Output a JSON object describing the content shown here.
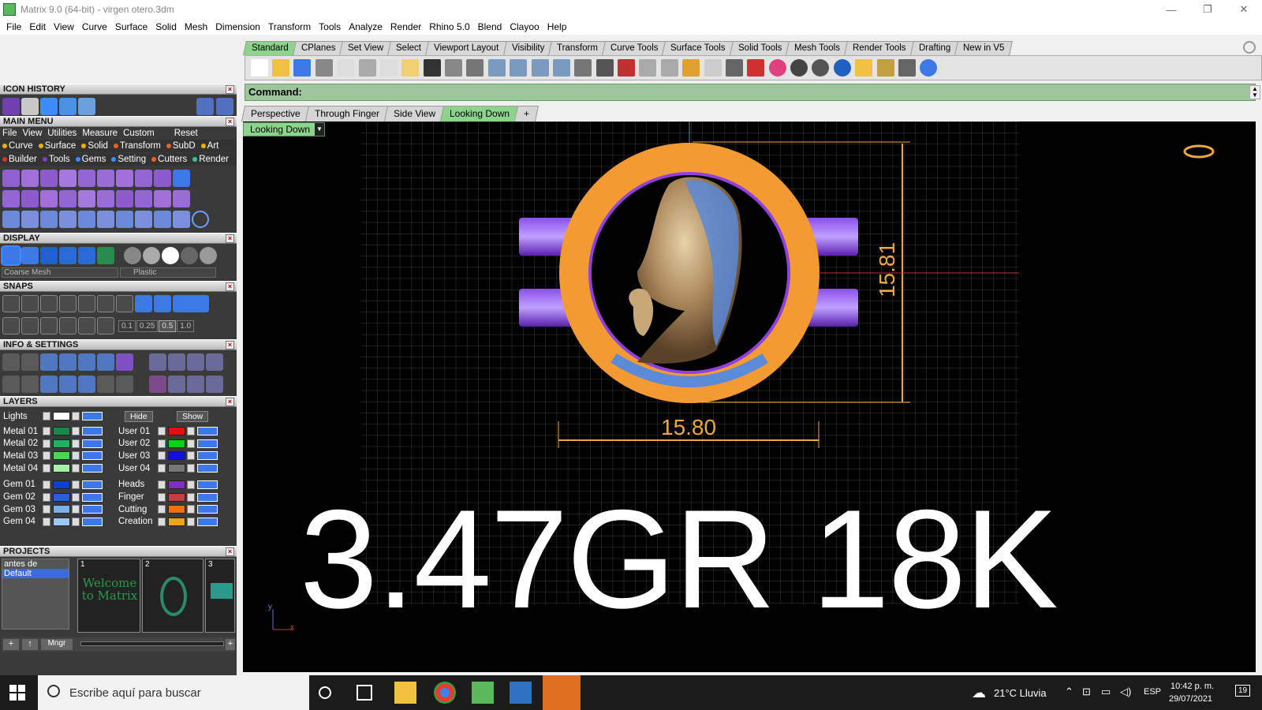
{
  "window": {
    "title": "Matrix 9.0 (64-bit) - virgen otero.3dm",
    "min": "—",
    "max": "❐",
    "close": "✕"
  },
  "menubar": [
    "File",
    "Edit",
    "View",
    "Curve",
    "Surface",
    "Solid",
    "Mesh",
    "Dimension",
    "Transform",
    "Tools",
    "Analyze",
    "Render",
    "Rhino 5.0",
    "Blend",
    "Clayoo",
    "Help"
  ],
  "left": {
    "icon_history": "ICON HISTORY",
    "main_menu": "MAIN MENU",
    "main_menu_items": [
      "File",
      "View",
      "Utilities",
      "Measure",
      "Custom"
    ],
    "reset": "Reset",
    "cat_row1": [
      "Curve",
      "Surface",
      "Solid",
      "Transform",
      "SubD",
      "Art"
    ],
    "cat_row2": [
      "Builder",
      "Tools",
      "Gems",
      "Setting",
      "Cutters",
      "Render"
    ],
    "display": "DISPLAY",
    "mesh_option": "Coarse Mesh",
    "material_option": "Plastic",
    "snaps": "SNAPS",
    "snap_values": [
      "0.1",
      "0.25",
      "0.5",
      "1.0"
    ],
    "info_settings": "INFO & SETTINGS",
    "layers": "LAYERS",
    "lights": "Lights",
    "hide": "Hide",
    "show": "Show",
    "layers_left": [
      {
        "name": "Metal 01",
        "color": "#138a4a"
      },
      {
        "name": "Metal 02",
        "color": "#22b060"
      },
      {
        "name": "Metal 03",
        "color": "#4ed44e"
      },
      {
        "name": "Metal 04",
        "color": "#a8f0a8"
      },
      {
        "name": "Gem 01",
        "color": "#1040c8"
      },
      {
        "name": "Gem 02",
        "color": "#2860d8"
      },
      {
        "name": "Gem 03",
        "color": "#7ab0f0"
      },
      {
        "name": "Gem 04",
        "color": "#9cc6f4"
      }
    ],
    "layers_right": [
      {
        "name": "User 01",
        "color": "#e01010"
      },
      {
        "name": "User 02",
        "color": "#10d010"
      },
      {
        "name": "User 03",
        "color": "#1010e0"
      },
      {
        "name": "User 04",
        "color": "#777777"
      },
      {
        "name": "Heads",
        "color": "#8030c0"
      },
      {
        "name": "Finger",
        "color": "#c04040"
      },
      {
        "name": "Cutting",
        "color": "#f07010"
      },
      {
        "name": "Creation",
        "color": "#f0a020"
      }
    ],
    "projects": "PROJECTS",
    "project_list": [
      "antes de",
      "Default"
    ],
    "project_thumbs": [
      "1",
      "2",
      "3"
    ],
    "thumb1_text": "Welcome to Matrix",
    "mngr": "Mngr"
  },
  "toolbar_tabs": [
    "Standard",
    "CPlanes",
    "Set View",
    "Select",
    "Viewport Layout",
    "Visibility",
    "Transform",
    "Curve Tools",
    "Surface Tools",
    "Solid Tools",
    "Mesh Tools",
    "Render Tools",
    "Drafting",
    "New in V5"
  ],
  "command_label": "Command:",
  "viewport_tabs": [
    "Perspective",
    "Through Finger",
    "Side View",
    "Looking Down",
    "+"
  ],
  "active_viewport": "Looking Down",
  "dimensions": {
    "width": "15.80",
    "height": "15.81"
  },
  "overlay_text": "3.47GR 18K",
  "axes": {
    "x": "x",
    "y": "y"
  },
  "taskbar": {
    "search_placeholder": "Escribe aquí para buscar",
    "weather": "21°C  Lluvia",
    "lang": "ESP",
    "time": "10:42 p. m.",
    "date": "29/07/2021",
    "notif": "19"
  }
}
